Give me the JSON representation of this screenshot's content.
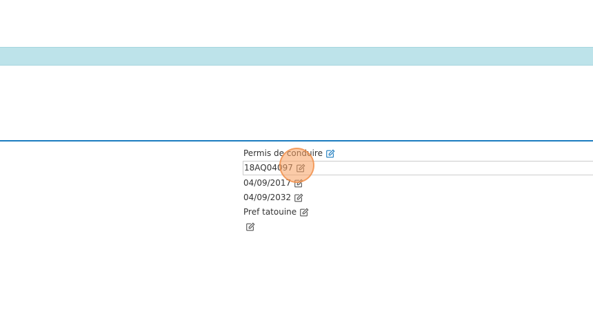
{
  "document_fields": {
    "type": "Permis de conduire",
    "number": "18AQ04097",
    "issue_date": "04/09/2017",
    "expiry_date": "04/09/2032",
    "issuer": "Pref tatouine",
    "extra": ""
  },
  "icons": {
    "edit": "pencil-square-icon"
  },
  "colors": {
    "top_band": "#bde3ea",
    "divider": "#1a7bbf",
    "accent_icon": "#1a7bbf",
    "click_marker": "#f7a060"
  }
}
